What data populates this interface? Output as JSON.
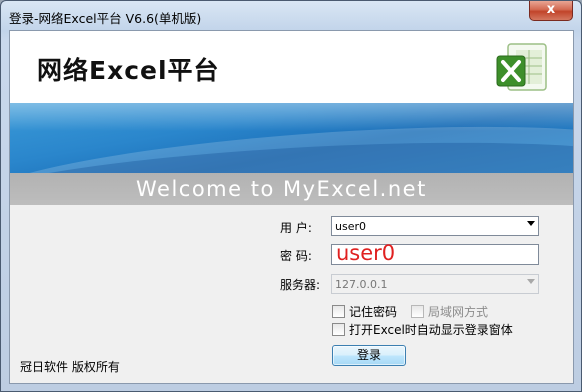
{
  "window": {
    "title": "登录-网络Excel平台 V6.6(单机版)",
    "close_glyph": "x"
  },
  "header": {
    "app_title": "网络Excel平台",
    "logo_icon": "excel-logo-icon"
  },
  "banner": {
    "welcome": "Welcome to MyExcel.net"
  },
  "form": {
    "user_label": "用  户:",
    "user_value": "user0",
    "password_label": "密  码:",
    "password_value": "user0",
    "server_label": "服务器:",
    "server_value": "127.0.0.1",
    "remember_label": "记住密码",
    "lan_label": "局域网方式",
    "open_excel_label": "打开Excel时自动显示登录窗体",
    "login_button": "登录"
  },
  "footer": {
    "copyright": "冠日软件  版权所有"
  },
  "colors": {
    "accent": "#2a86cc",
    "password_text": "#e02020"
  }
}
